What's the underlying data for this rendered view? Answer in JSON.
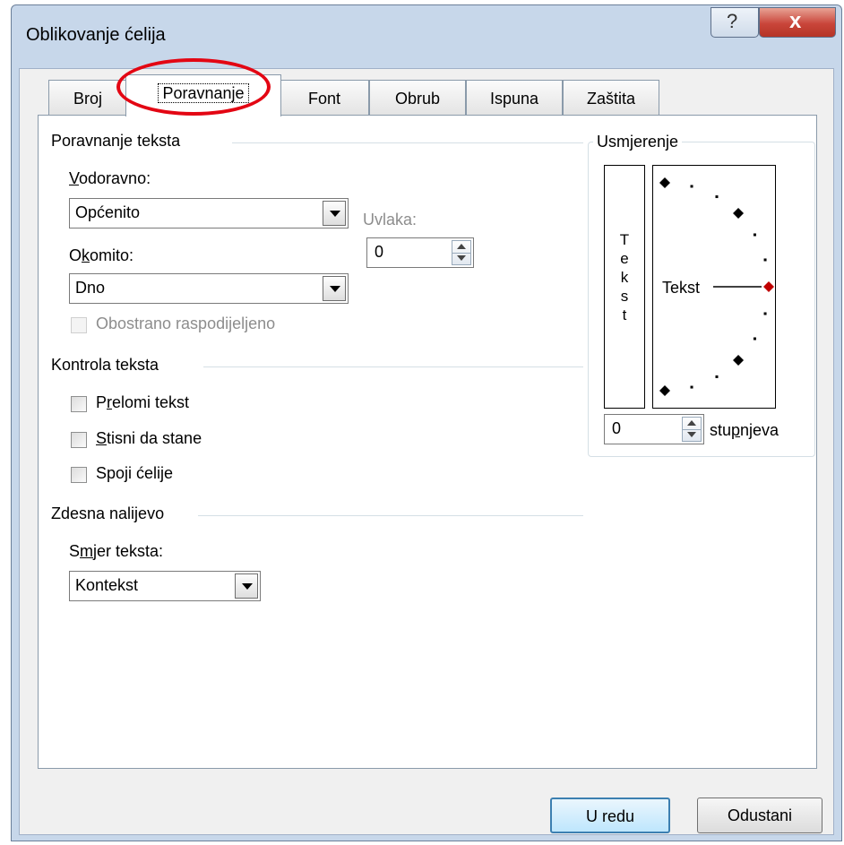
{
  "window": {
    "title": "Oblikovanje ćelija",
    "help_glyph": "?",
    "close_glyph": "x"
  },
  "tabs": [
    {
      "label": "Broj"
    },
    {
      "label": "Poravnanje"
    },
    {
      "label": "Font"
    },
    {
      "label": "Obrub"
    },
    {
      "label": "Ispuna"
    },
    {
      "label": "Zaštita"
    }
  ],
  "alignment": {
    "group_title": "Poravnanje teksta",
    "horizontal_label_u": "V",
    "horizontal_label_rest": "odoravno:",
    "horizontal_value": "Općenito",
    "indent_label": "Uvlaka:",
    "indent_value": "0",
    "vertical_label_a": "O",
    "vertical_label_u": "k",
    "vertical_label_b": "omito:",
    "vertical_value": "Dno",
    "justify_distributed": "Obostrano raspodijeljeno"
  },
  "text_control": {
    "group_title": "Kontrola teksta",
    "wrap_a": "P",
    "wrap_u": "r",
    "wrap_b": "elomi tekst",
    "shrink_u": "S",
    "shrink_b": "tisni da stane",
    "merge_a": "Spo",
    "merge_u": "j",
    "merge_b": "i ćelije"
  },
  "rtl": {
    "group_title": "Zdesna nalijevo",
    "direction_label_a": "S",
    "direction_label_u": "m",
    "direction_label_b": "jer teksta:",
    "direction_value": "Kontekst"
  },
  "orientation": {
    "group_title": "Usmjerenje",
    "vertical_text": [
      "T",
      "e",
      "k",
      "s",
      "t"
    ],
    "dial_text": "Tekst",
    "degrees_value": "0",
    "degrees_label_a": "stu",
    "degrees_label_u": "p",
    "degrees_label_b": "njeva",
    "accent_color": "#c00000"
  },
  "footer": {
    "ok_label": "U redu",
    "cancel_label": "Odustani"
  },
  "annotation": {
    "highlight_color": "#e30613"
  }
}
